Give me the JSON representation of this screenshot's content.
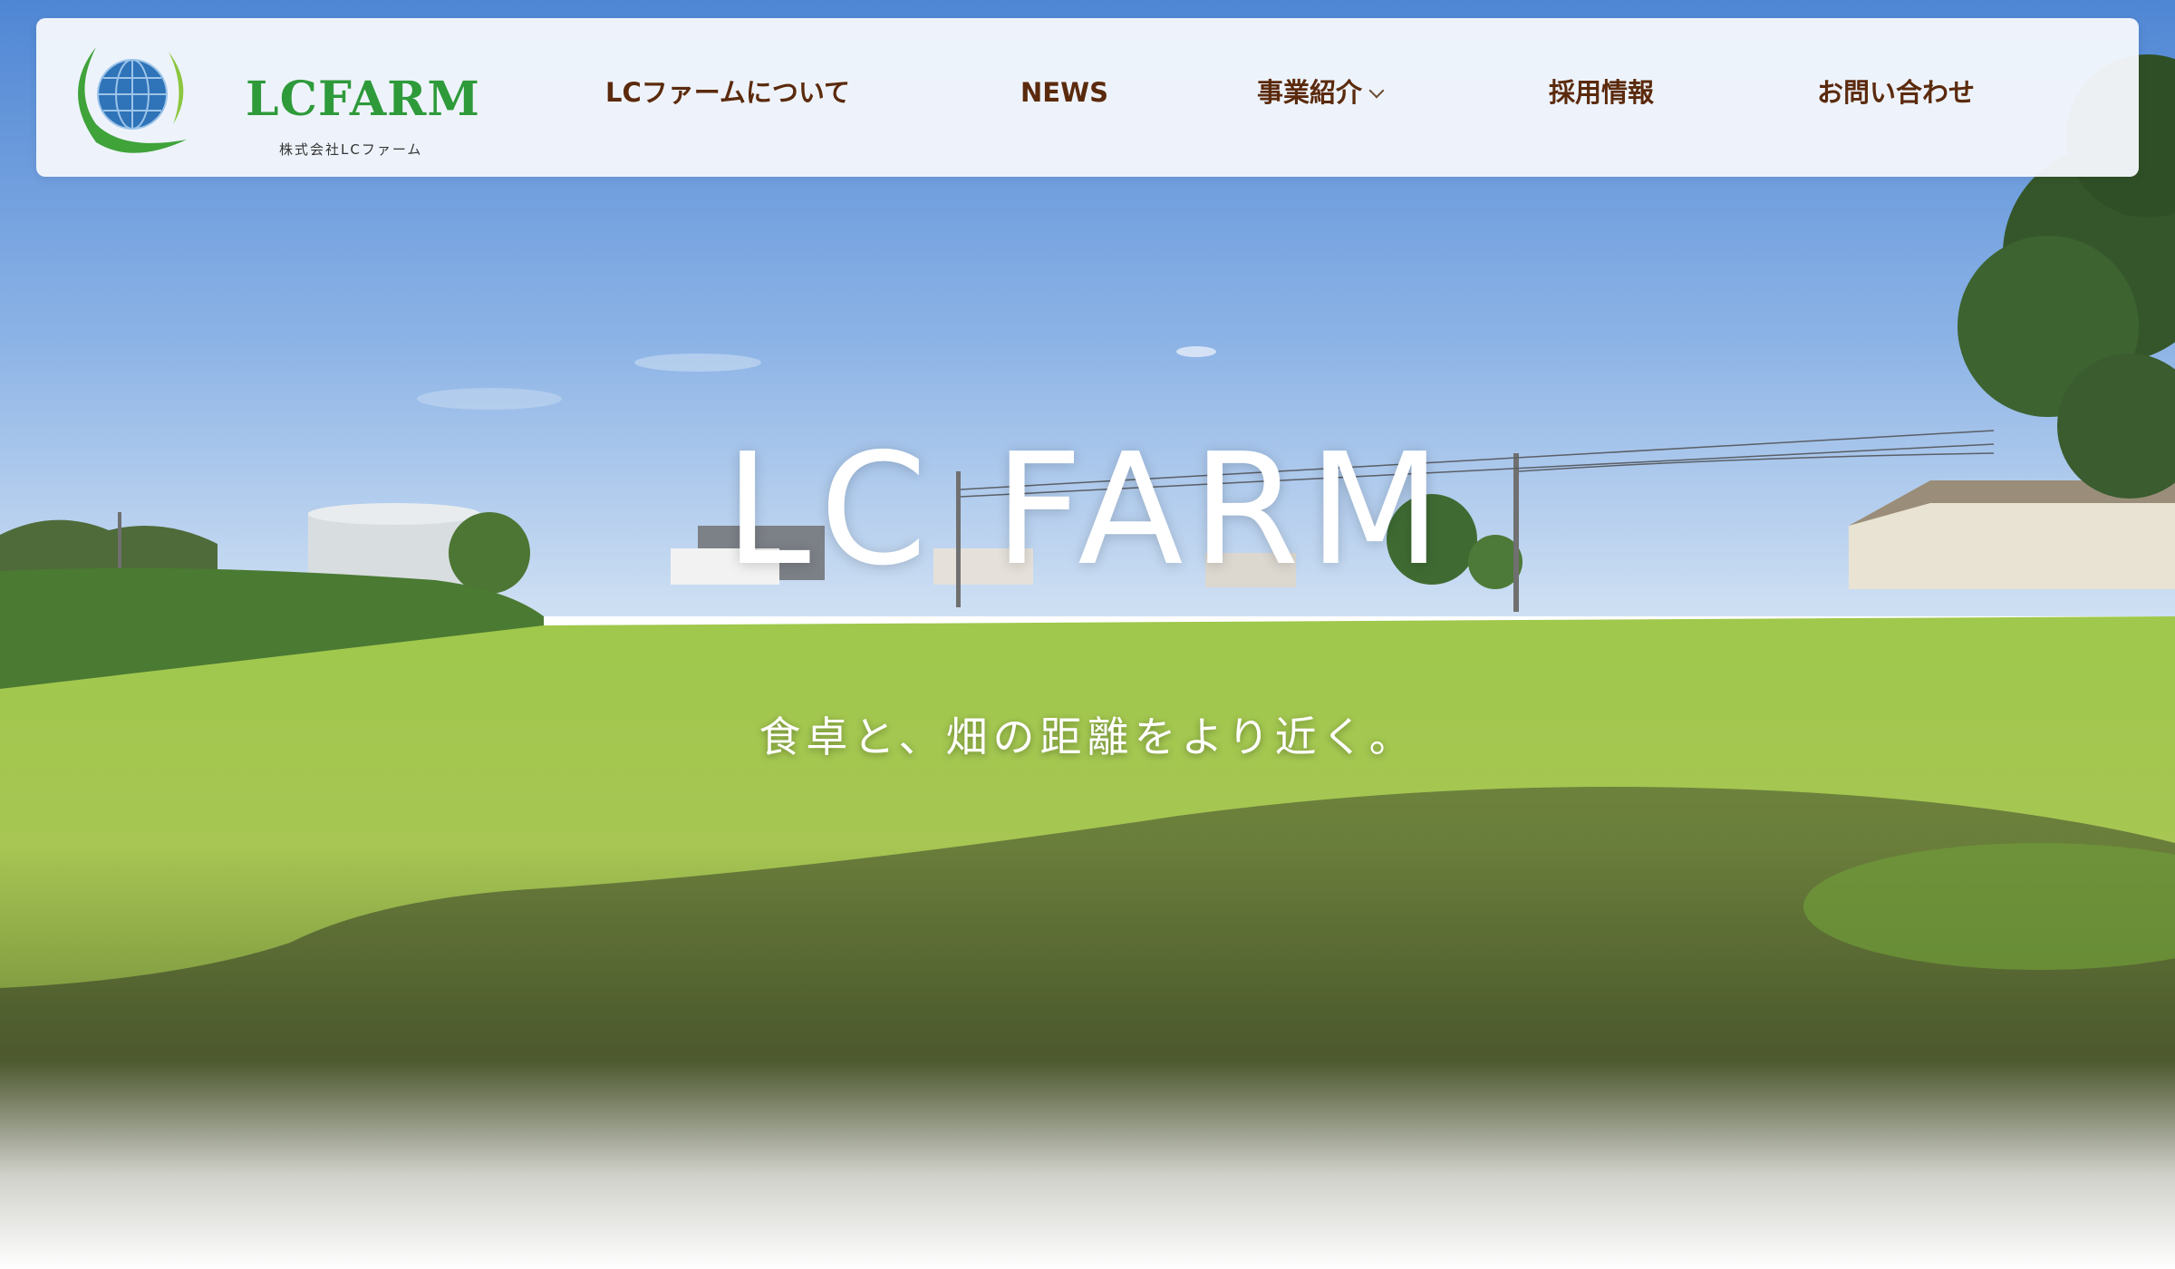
{
  "header": {
    "logo": {
      "name": "LCFARM",
      "company": "株式会社LCファーム",
      "icon": "globe-leaf-icon"
    },
    "nav": [
      {
        "label": "LCファームについて"
      },
      {
        "label": "NEWS"
      },
      {
        "label": "事業紹介",
        "has_dropdown": true,
        "icon": "chevron-down-icon"
      },
      {
        "label": "採用情報"
      },
      {
        "label": "お問い合わせ"
      }
    ]
  },
  "hero": {
    "title": "LC FARM",
    "tagline": "食卓と、畑の距離をより近く。"
  },
  "colors": {
    "brand_green": "#2e9a3a",
    "nav_text": "#5b2a0d",
    "sky": "#5b8fd6",
    "field": "#9cc34a"
  }
}
